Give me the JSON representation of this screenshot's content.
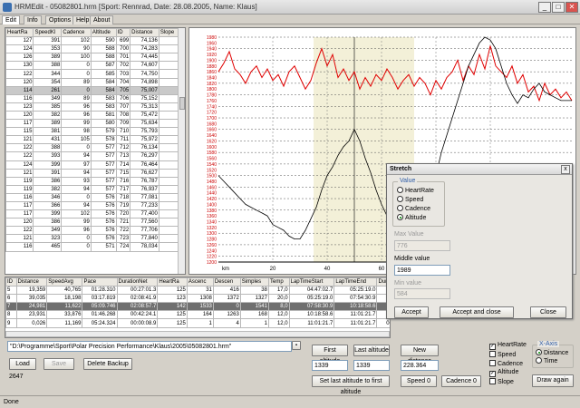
{
  "window": {
    "title": "HRMEdit - 05082801.hrm [Sport: Rennrad, Date: 28.08.2005, Name: Klaus]",
    "minimize": "_",
    "maximize": "□",
    "close": "✕"
  },
  "menu": [
    "Edit",
    "Info",
    "Options",
    "Help",
    "About"
  ],
  "samples": {
    "headers": [
      "HeartRa",
      "SpeedKl",
      "Cadence",
      "Altitude",
      "ID",
      "Distance",
      "Slope"
    ],
    "rows": [
      [
        "127",
        "391",
        "102",
        "590",
        "699",
        "74,136",
        ""
      ],
      [
        "124",
        "353",
        "90",
        "588",
        "700",
        "74,283",
        ""
      ],
      [
        "126",
        "389",
        "100",
        "588",
        "701",
        "74,445",
        ""
      ],
      [
        "130",
        "388",
        "0",
        "587",
        "702",
        "74,607",
        ""
      ],
      [
        "122",
        "344",
        "0",
        "585",
        "703",
        "74,750",
        ""
      ],
      [
        "120",
        "354",
        "89",
        "584",
        "704",
        "74,898",
        ""
      ],
      [
        "114",
        "261",
        "0",
        "584",
        "705",
        "75,007",
        ""
      ],
      [
        "116",
        "349",
        "89",
        "583",
        "706",
        "75,152",
        ""
      ],
      [
        "123",
        "385",
        "96",
        "583",
        "707",
        "75,313",
        ""
      ],
      [
        "120",
        "382",
        "96",
        "581",
        "708",
        "75,472",
        ""
      ],
      [
        "117",
        "389",
        "99",
        "580",
        "709",
        "75,634",
        ""
      ],
      [
        "115",
        "381",
        "98",
        "579",
        "710",
        "75,793",
        ""
      ],
      [
        "121",
        "431",
        "105",
        "578",
        "711",
        "75,972",
        ""
      ],
      [
        "122",
        "388",
        "0",
        "577",
        "712",
        "76,134",
        ""
      ],
      [
        "122",
        "393",
        "94",
        "577",
        "713",
        "76,297",
        ""
      ],
      [
        "124",
        "399",
        "97",
        "577",
        "714",
        "76,464",
        ""
      ],
      [
        "121",
        "391",
        "94",
        "577",
        "715",
        "76,627",
        ""
      ],
      [
        "119",
        "386",
        "93",
        "577",
        "716",
        "76,787",
        ""
      ],
      [
        "119",
        "382",
        "94",
        "577",
        "717",
        "76,937",
        ""
      ],
      [
        "116",
        "346",
        "0",
        "576",
        "718",
        "77,081",
        ""
      ],
      [
        "117",
        "366",
        "94",
        "576",
        "719",
        "77,233",
        ""
      ],
      [
        "117",
        "399",
        "102",
        "576",
        "720",
        "77,400",
        ""
      ],
      [
        "120",
        "386",
        "99",
        "576",
        "721",
        "77,560",
        ""
      ],
      [
        "122",
        "349",
        "96",
        "576",
        "722",
        "77,706",
        ""
      ],
      [
        "121",
        "323",
        "0",
        "576",
        "723",
        "77,840",
        ""
      ],
      [
        "116",
        "465",
        "0",
        "571",
        "724",
        "78,034",
        ""
      ]
    ]
  },
  "chart_data": {
    "type": "line",
    "y_ticks": [
      "1980",
      "1960",
      "1940",
      "1920",
      "1900",
      "1880",
      "1860",
      "1840",
      "1820",
      "1800",
      "1780",
      "1760",
      "1740",
      "1720",
      "1700",
      "1680",
      "1660",
      "1640",
      "1620",
      "1600",
      "1580",
      "1560",
      "1540",
      "1520",
      "1500",
      "1480",
      "1460",
      "1440",
      "1420",
      "1400",
      "1380",
      "1360",
      "1340",
      "1320",
      "1300",
      "1280",
      "1260",
      "1240",
      "1220",
      "1200"
    ],
    "ylim": [
      1200,
      1980
    ],
    "x_ticks": [
      "km",
      "20",
      "40",
      "60",
      "80",
      "100"
    ],
    "xlim": [
      0,
      130
    ],
    "highlight_range": [
      35,
      72
    ],
    "cursor_x": 50,
    "series": [
      {
        "color": "#e00000",
        "x": [
          0,
          2,
          4,
          6,
          8,
          10,
          12,
          14,
          16,
          18,
          20,
          22,
          24,
          26,
          28,
          30,
          32,
          34,
          36,
          38,
          40,
          42,
          44,
          46,
          48,
          50,
          52,
          54,
          56,
          58,
          60,
          62,
          64,
          66,
          68,
          70,
          72,
          74,
          76,
          78,
          80,
          82,
          84,
          86,
          88,
          90,
          92,
          94,
          96,
          98,
          100,
          102,
          104,
          106,
          108,
          110,
          112,
          114,
          116,
          118,
          120,
          122,
          124,
          126,
          128,
          130
        ],
        "y": [
          1860,
          1890,
          1930,
          1870,
          1850,
          1820,
          1860,
          1880,
          1840,
          1870,
          1830,
          1850,
          1810,
          1860,
          1880,
          1840,
          1800,
          1830,
          1890,
          1940,
          1880,
          1920,
          1840,
          1870,
          1830,
          1860,
          1800,
          1840,
          1810,
          1850,
          1830,
          1870,
          1840,
          1800,
          1830,
          1850,
          1810,
          1840,
          1820,
          1780,
          1830,
          1800,
          1840,
          1860,
          1900,
          1830,
          1880,
          1850,
          1920,
          1870,
          1950,
          1880,
          1860,
          1840,
          1880,
          1820,
          1850,
          1790,
          1810,
          1760,
          1820,
          1780,
          1800,
          1770,
          1790,
          1760
        ]
      },
      {
        "color": "#000000",
        "x": [
          0,
          2,
          4,
          6,
          8,
          10,
          12,
          14,
          16,
          18,
          20,
          22,
          24,
          26,
          28,
          30,
          32,
          34,
          36,
          38,
          40,
          42,
          44,
          46,
          48,
          50,
          52,
          54,
          56,
          58,
          60,
          62,
          64,
          66,
          68,
          70,
          72,
          74,
          76,
          78,
          80,
          82,
          84,
          86,
          88,
          90,
          92,
          94,
          96,
          98,
          100,
          102,
          104,
          106,
          108,
          110,
          112,
          114,
          116,
          118,
          120,
          122,
          124,
          126,
          128,
          130
        ],
        "y": [
          1500,
          1480,
          1460,
          1440,
          1420,
          1400,
          1390,
          1380,
          1370,
          1360,
          1330,
          1320,
          1310,
          1290,
          1280,
          1280,
          1310,
          1350,
          1390,
          1450,
          1500,
          1530,
          1570,
          1600,
          1620,
          1660,
          1620,
          1560,
          1510,
          1450,
          1400,
          1360,
          1330,
          1290,
          1270,
          1250,
          1270,
          1310,
          1350,
          1420,
          1500,
          1580,
          1640,
          1700,
          1760,
          1820,
          1880,
          1920,
          1960,
          1980,
          1970,
          1940,
          1880,
          1820,
          1780,
          1750,
          1780,
          1770,
          1800,
          1820,
          1790,
          1780,
          1770,
          1760,
          1760,
          1760
        ]
      }
    ]
  },
  "laps": {
    "headers": [
      "ID",
      "Distance",
      "SpeedAvg",
      "Pace",
      "DurationNet",
      "HeartRa",
      "Ascenc",
      "Descen",
      "Simples",
      "Temp",
      "LapTimeStart",
      "LapTimeEnd",
      "Duration",
      "FirstSample",
      "LastSample"
    ],
    "rows": [
      [
        "5",
        "19,359",
        "40,765",
        "01:28.310",
        "00:27:01.3",
        "125",
        "31",
        "416",
        "38",
        "17,0",
        "04:47:02.7",
        "05:25:19.0",
        "00:38:16.3",
        "1149,18",
        "1302,27"
      ],
      [
        "6",
        "39,035",
        "18,198",
        "03:17.819",
        "02:08:41.9",
        "123",
        "1308",
        "1372",
        "1327",
        "20,0",
        "05:25:19.0",
        "07:54:30.9",
        "02:29:11.9",
        "1302,27",
        "1899,08"
      ],
      [
        "7",
        "24,981",
        "11,622",
        "05:09.746",
        "02:08:57.7",
        "142",
        "1533",
        "0",
        "1541",
        "8,0",
        "07:58:30.9",
        "10:18:58.6",
        "02:19:27.7",
        "1899,08",
        "2476,81"
      ],
      [
        "8",
        "23,931",
        "33,876",
        "01:46.268",
        "00:42:24.1",
        "125",
        "164",
        "1263",
        "168",
        "12,0",
        "10:18:58.6",
        "11:01:21.7",
        "00:42:21.1",
        "2476,81",
        "2646,45"
      ],
      [
        "9",
        "0,026",
        "11,169",
        "05:24.324",
        "00:00:08.9",
        "125",
        "1",
        "4",
        "1",
        "12,0",
        "11:01:21.7",
        "11:01:21.7",
        "00:00:00.0",
        "2646,45",
        "2646,45"
      ]
    ]
  },
  "file": {
    "path": "\"D:\\Programme\\Sport\\Polar Precision Performance\\Klaus\\2005\\05082801.hrm\"",
    "load": "Load",
    "save": "Save",
    "delete_backup": "Delete Backup",
    "count": "2647"
  },
  "altitude": {
    "first_btn": "First altitude",
    "last_btn": "Last altitude",
    "first_val": "1339",
    "last_val": "1339",
    "set_btn": "Set last altitude to first altitude"
  },
  "distance": {
    "new_btn": "New distance",
    "value": "228.364",
    "speed_btn": "Speed 0",
    "cadence_btn": "Cadence 0"
  },
  "series_toggles": {
    "items": [
      {
        "label": "HeartRate",
        "checked": true
      },
      {
        "label": "Speed",
        "checked": false
      },
      {
        "label": "Cadence",
        "checked": false
      },
      {
        "label": "Altitude",
        "checked": true
      },
      {
        "label": "Slope",
        "checked": false
      }
    ],
    "xaxis_label": "X-Axis",
    "xaxis_options": [
      {
        "label": "Distance",
        "selected": true
      },
      {
        "label": "Time",
        "selected": false
      }
    ],
    "draw_btn": "Draw again"
  },
  "stretch_dialog": {
    "title": "Stretch",
    "close": "x",
    "value_legend": "Value",
    "options": [
      {
        "label": "HeartRate",
        "selected": false
      },
      {
        "label": "Speed",
        "selected": false
      },
      {
        "label": "Cadence",
        "selected": false
      },
      {
        "label": "Altitude",
        "selected": true
      }
    ],
    "max_label": "Max Value",
    "max_value": "776",
    "middle_label": "Middle value",
    "middle_value": "1989",
    "min_label": "Min value",
    "min_value": "584",
    "accept": "Accept",
    "accept_close": "Accept and close",
    "close_btn": "Close"
  },
  "status": "Done"
}
